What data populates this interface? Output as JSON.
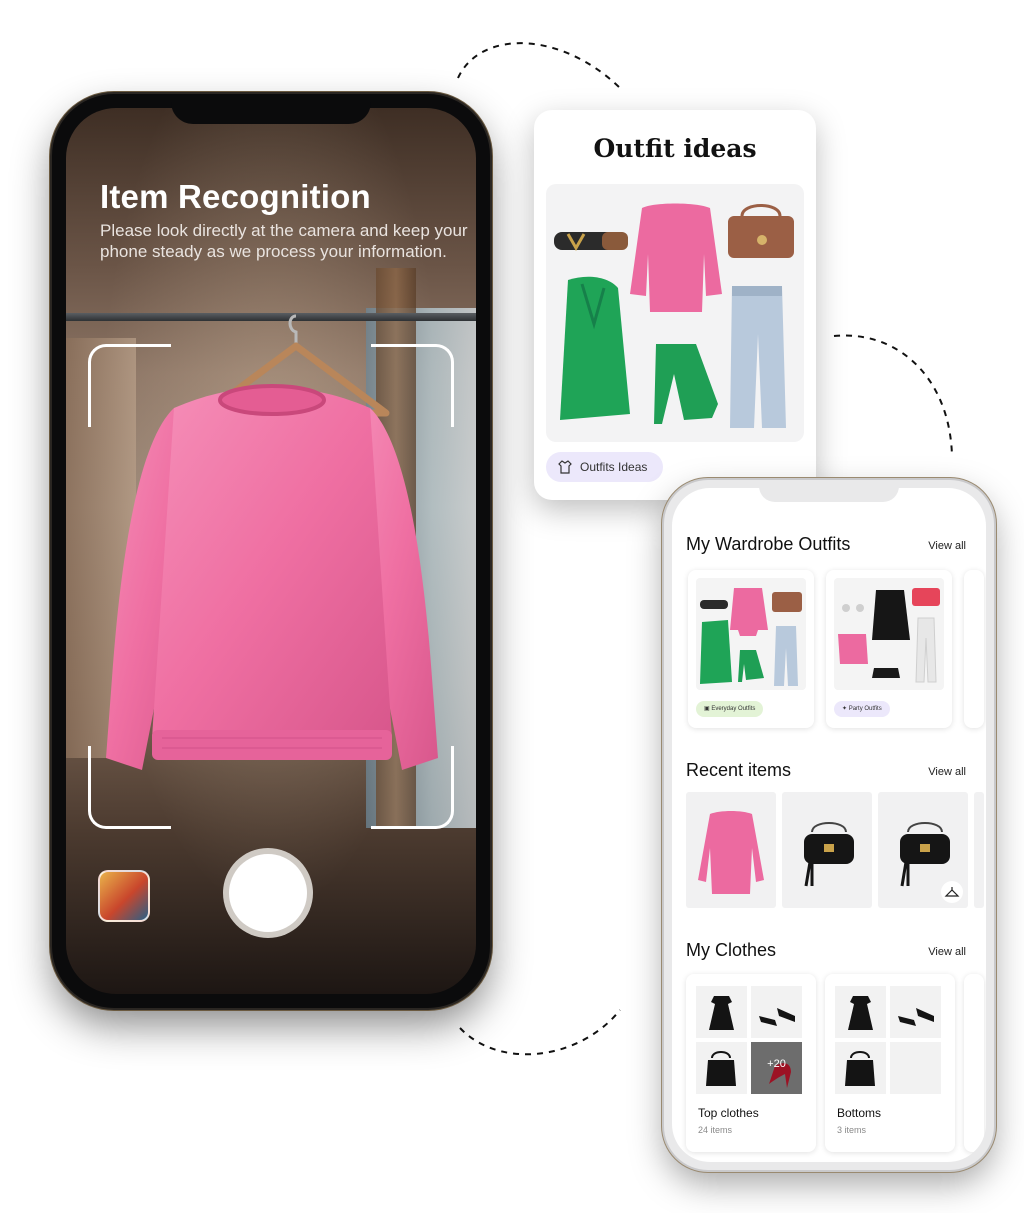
{
  "item_recognition": {
    "title": "Item Recognition",
    "subtitle": "Please look directly at the camera and keep your phone steady as we process your information."
  },
  "outfit_card": {
    "title": "Outfit ideas",
    "chip_label": "Outfits Ideas"
  },
  "wardrobe": {
    "outfits_section": {
      "title": "My Wardrobe Outfits",
      "view_all": "View all",
      "cards": [
        {
          "tag": "Everyday Outfits",
          "tag_color": "#e3f3d6"
        },
        {
          "tag": "Party Outfits",
          "tag_color": "#ece8fb"
        }
      ]
    },
    "recent_section": {
      "title": "Recent items",
      "view_all": "View all"
    },
    "clothes_section": {
      "title": "My Clothes",
      "view_all": "View all",
      "cards": [
        {
          "name": "Top clothes",
          "count": "24 items",
          "more_badge": "+20"
        },
        {
          "name": "Bottoms",
          "count": "3 items"
        }
      ]
    }
  },
  "colors": {
    "sweater_pink": "#f06ea3",
    "accent_lavender": "#ece8fb",
    "accent_green": "#e3f3d6"
  }
}
